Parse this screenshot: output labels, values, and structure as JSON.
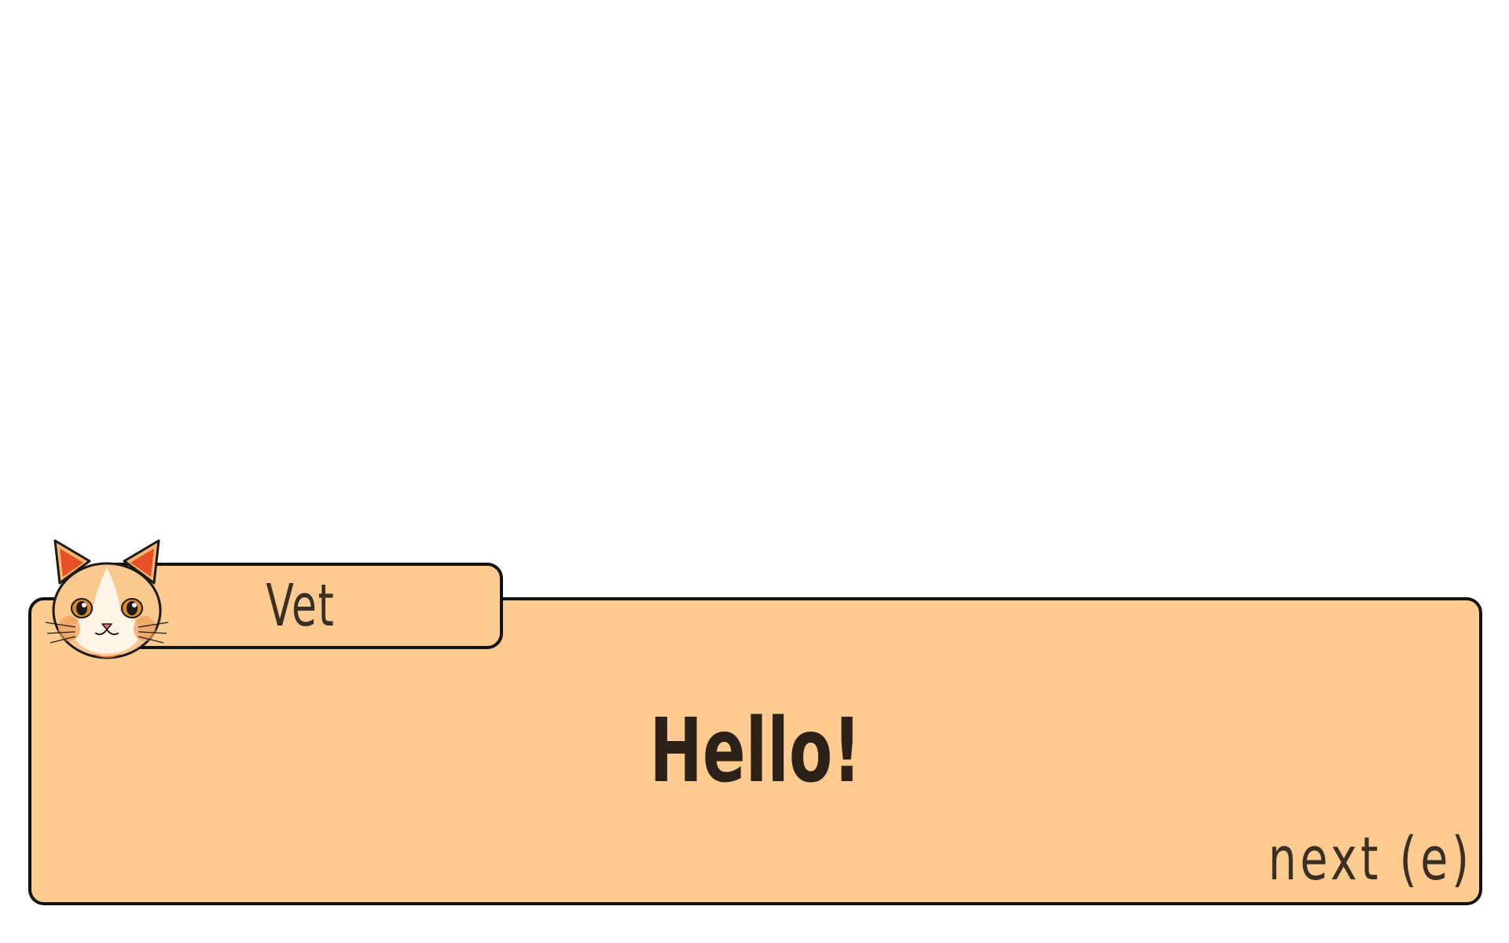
{
  "dialog": {
    "speaker_name": "Vet",
    "message": "Hello!",
    "next_prompt": "next (e)",
    "portrait_icon": "cat-face-icon"
  },
  "colors": {
    "panel": "#FDCB90",
    "border": "#111111",
    "text": "#2b2118",
    "background": "#ffffff"
  }
}
